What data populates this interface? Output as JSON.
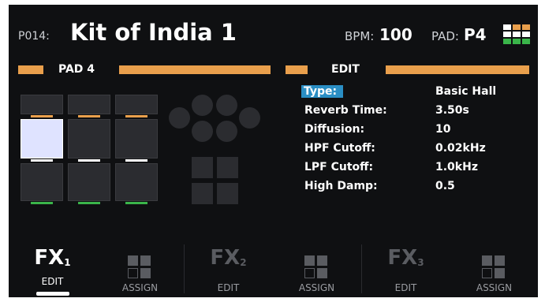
{
  "header": {
    "patch_num": "P014:",
    "kit_name": "Kit of India 1",
    "bpm_label": "BPM:",
    "bpm_value": "100",
    "pad_label": "PAD:",
    "pad_value": "P4"
  },
  "pad_panel": {
    "title": "PAD 4"
  },
  "edit_panel": {
    "title": "EDIT",
    "params": [
      {
        "label": "Type:",
        "value": "Basic Hall",
        "selected": true
      },
      {
        "label": "Reverb Time:",
        "value": "3.50s"
      },
      {
        "label": "Diffusion:",
        "value": "10"
      },
      {
        "label": "HPF Cutoff:",
        "value": "0.02kHz"
      },
      {
        "label": "LPF Cutoff:",
        "value": "1.0kHz"
      },
      {
        "label": "High Damp:",
        "value": "0.5"
      }
    ]
  },
  "nav": [
    {
      "fx": "FX",
      "sub": "1",
      "caption": "EDIT",
      "active": true
    },
    {
      "icon": "assign-grid-icon",
      "caption": "ASSIGN"
    },
    {
      "fx": "FX",
      "sub": "2",
      "caption": "EDIT"
    },
    {
      "icon": "assign-grid-icon",
      "caption": "ASSIGN"
    },
    {
      "fx": "FX",
      "sub": "3",
      "caption": "EDIT"
    },
    {
      "icon": "assign-grid-icon",
      "caption": "ASSIGN"
    }
  ],
  "colors": {
    "accent_orange": "#e99f4c",
    "select_blue": "#2a8ec4",
    "pad_green": "#3ab54a",
    "pad_active": "#dfe3ff"
  }
}
